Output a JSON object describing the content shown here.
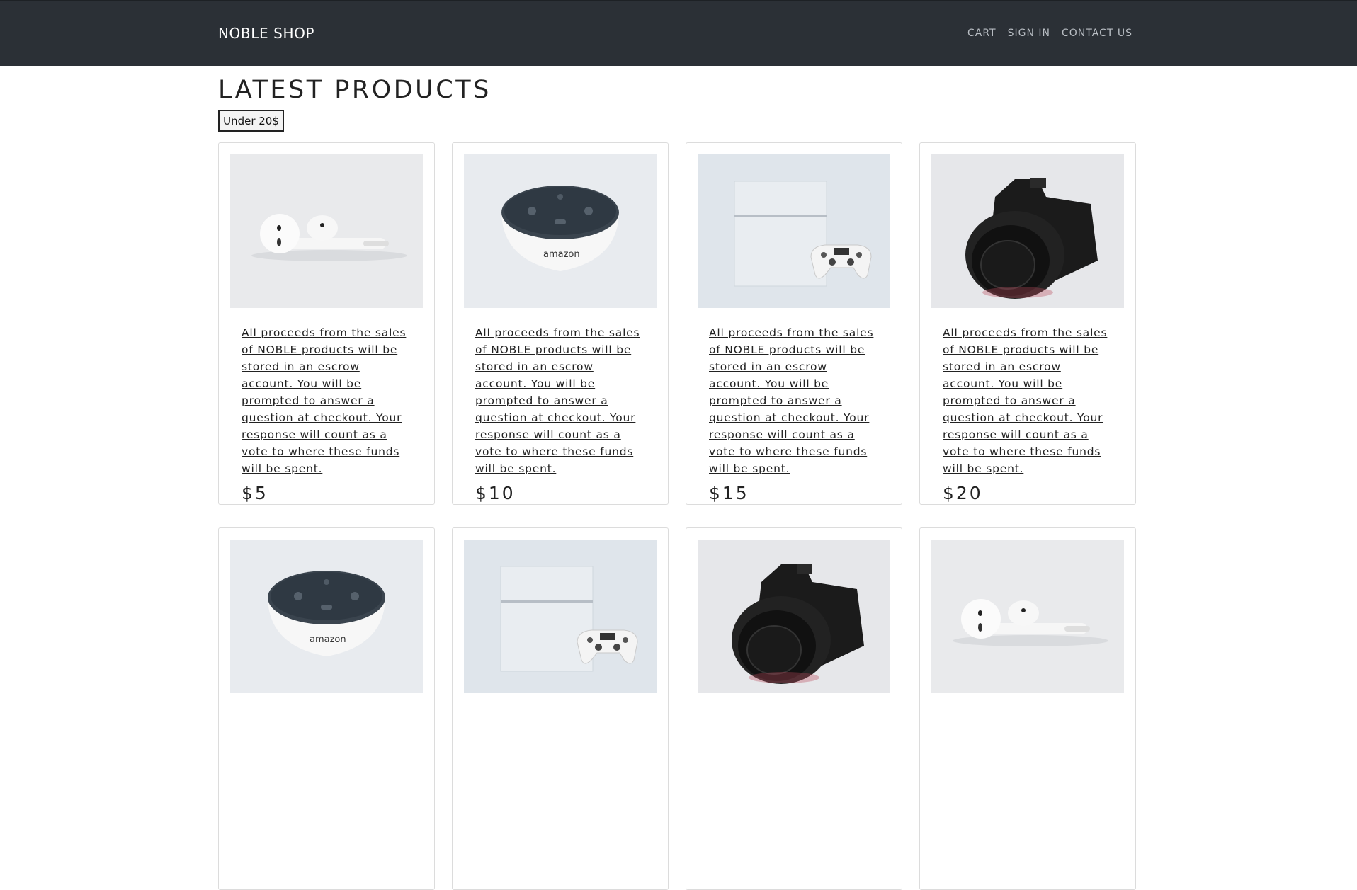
{
  "brand": "NOBLE SHOP",
  "nav": [
    "CART",
    "SIGN IN",
    "CONTACT US"
  ],
  "page_title": "LATEST PRODUCTS",
  "filter_label": "Under 20$",
  "colors": {
    "navbar": "#2b3036",
    "accent": "#222222"
  },
  "products": [
    {
      "image": "airpods",
      "description": "All proceeds from the sales of NOBLE products will be stored in an escrow account. You will be prompted to answer a question at checkout. Your response will count as a vote to where these funds will be spent.",
      "price": "$5"
    },
    {
      "image": "echo-dot",
      "description": "All proceeds from the sales of NOBLE products will be stored in an escrow account. You will be prompted to answer a question at checkout. Your response will count as a vote to where these funds will be spent.",
      "price": "$10"
    },
    {
      "image": "console",
      "description": "All proceeds from the sales of NOBLE products will be stored in an escrow account. You will be prompted to answer a question at checkout. Your response will count as a vote to where these funds will be spent.",
      "price": "$15"
    },
    {
      "image": "camera",
      "description": "All proceeds from the sales of NOBLE products will be stored in an escrow account. You will be prompted to answer a question at checkout. Your response will count as a vote to where these funds will be spent.",
      "price": "$20"
    },
    {
      "image": "echo-dot",
      "description": "",
      "price": ""
    },
    {
      "image": "console",
      "description": "",
      "price": ""
    },
    {
      "image": "camera",
      "description": "",
      "price": ""
    },
    {
      "image": "airpods",
      "description": "",
      "price": ""
    }
  ]
}
